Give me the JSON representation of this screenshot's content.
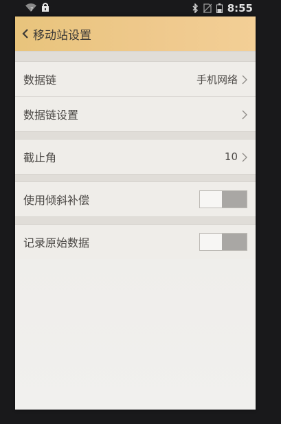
{
  "status_bar": {
    "time": "8:55",
    "wifi_badge": "?",
    "icons": [
      "wifi-icon",
      "lock-icon",
      "bluetooth-icon",
      "no-sim-icon",
      "battery-icon"
    ]
  },
  "app_bar": {
    "title": "移动站设置",
    "back_icon": "chevron-left-icon",
    "color": "#efc98d"
  },
  "settings": {
    "datalink": {
      "label": "数据链",
      "value": "手机网络"
    },
    "datalink_settings": {
      "label": "数据链设置"
    },
    "cutoff_angle": {
      "label": "截止角",
      "value": "10"
    },
    "tilt_compensation": {
      "label": "使用倾斜补偿",
      "enabled": false
    },
    "record_raw_data": {
      "label": "记录原始数据",
      "enabled": false
    }
  }
}
